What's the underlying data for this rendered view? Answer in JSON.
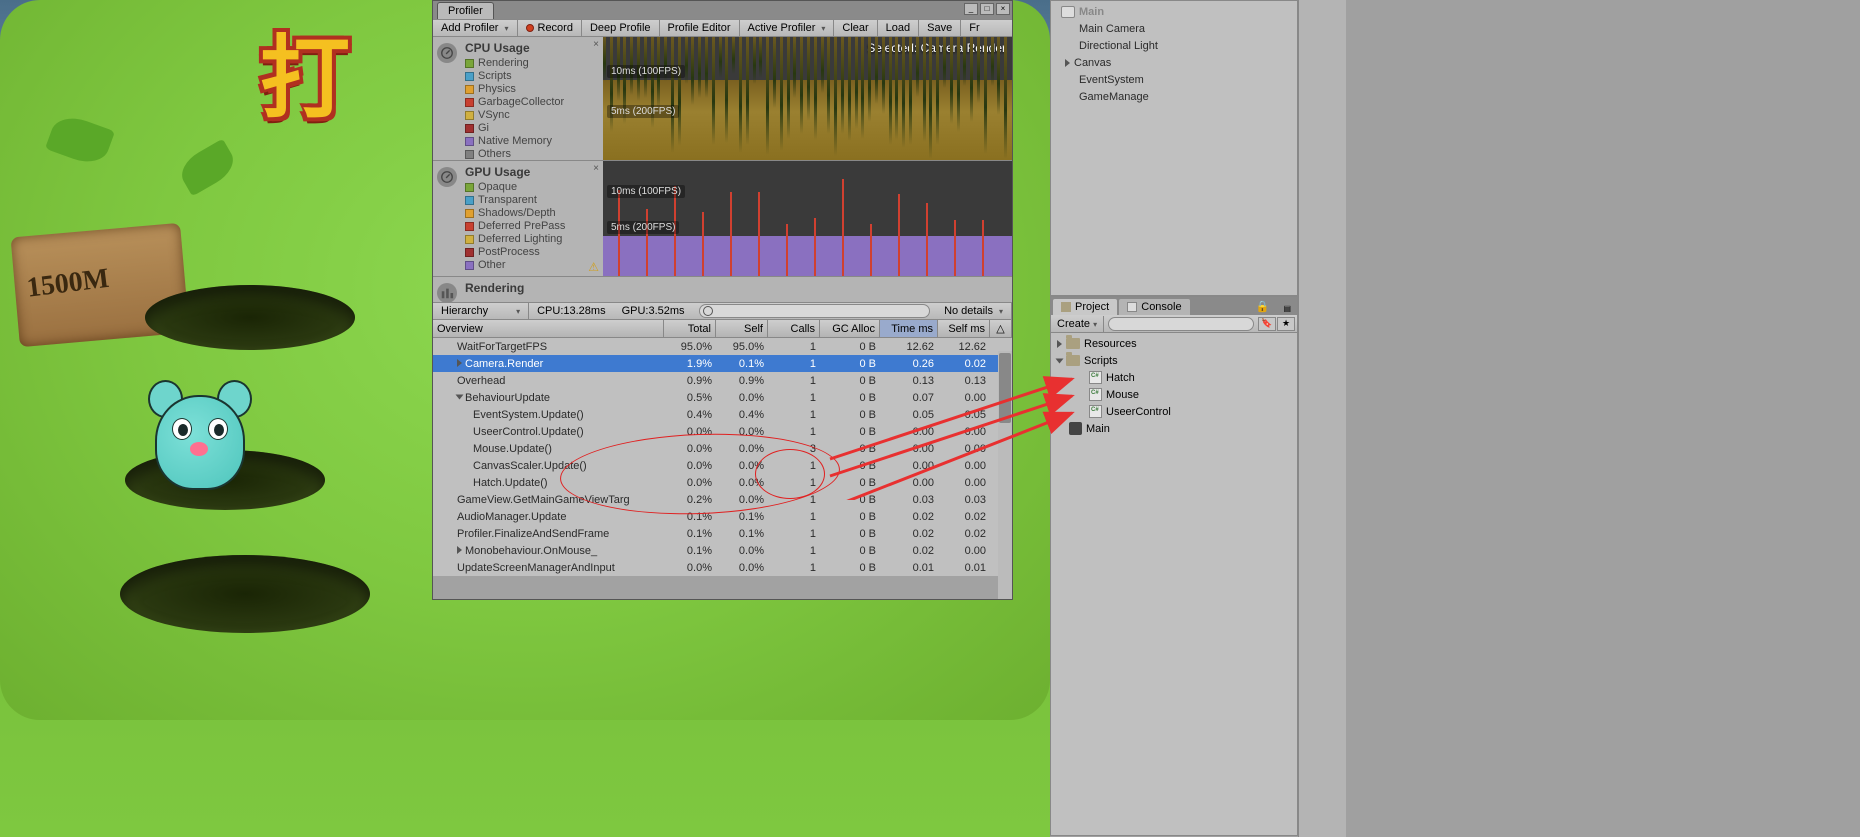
{
  "game": {
    "sign_text": "1500M"
  },
  "profiler": {
    "tab": "Profiler",
    "toolbar": {
      "add": "Add Profiler",
      "record": "Record",
      "deep": "Deep Profile",
      "editor": "Profile Editor",
      "active": "Active Profiler",
      "clear": "Clear",
      "load": "Load",
      "save": "Save",
      "frame": "Fr"
    },
    "cpu": {
      "title": "CPU Usage",
      "selected": "Selected: Camera.Render",
      "labels": {
        "l10": "10ms (100FPS)",
        "l5": "5ms (200FPS)"
      },
      "legend": [
        {
          "name": "Rendering",
          "color": "#7aa63a"
        },
        {
          "name": "Scripts",
          "color": "#4aa0c8"
        },
        {
          "name": "Physics",
          "color": "#e0a030"
        },
        {
          "name": "GarbageCollector",
          "color": "#c84030"
        },
        {
          "name": "VSync",
          "color": "#d0b040"
        },
        {
          "name": "Gi",
          "color": "#a03030"
        },
        {
          "name": "Native Memory",
          "color": "#8a70c0"
        },
        {
          "name": "Others",
          "color": "#808080"
        }
      ]
    },
    "gpu": {
      "title": "GPU Usage",
      "labels": {
        "l10": "10ms (100FPS)",
        "l5": "5ms (200FPS)"
      },
      "legend": [
        {
          "name": "Opaque",
          "color": "#7aa63a"
        },
        {
          "name": "Transparent",
          "color": "#4aa0c8"
        },
        {
          "name": "Shadows/Depth",
          "color": "#e0a030"
        },
        {
          "name": "Deferred PrePass",
          "color": "#c84030"
        },
        {
          "name": "Deferred Lighting",
          "color": "#d0b040"
        },
        {
          "name": "PostProcess",
          "color": "#a03030"
        },
        {
          "name": "Other",
          "color": "#8a70c0"
        }
      ]
    },
    "rendering": {
      "title": "Rendering"
    },
    "details": {
      "mode": "Hierarchy",
      "cpu_stat": "CPU:13.28ms",
      "gpu_stat": "GPU:3.52ms",
      "no_details": "No details"
    },
    "columns": {
      "overview": "Overview",
      "total": "Total",
      "self": "Self",
      "calls": "Calls",
      "gc": "GC Alloc",
      "time": "Time ms",
      "selfms": "Self ms",
      "tri": "△"
    },
    "rows": [
      {
        "name": "WaitForTargetFPS",
        "indent": 1,
        "total": "95.0%",
        "self": "95.0%",
        "calls": "1",
        "gc": "0 B",
        "time": "12.62",
        "selfms": "12.62"
      },
      {
        "name": "Camera.Render",
        "indent": 1,
        "fold": true,
        "total": "1.9%",
        "self": "0.1%",
        "calls": "1",
        "gc": "0 B",
        "time": "0.26",
        "selfms": "0.02",
        "selected": true
      },
      {
        "name": "Overhead",
        "indent": 1,
        "total": "0.9%",
        "self": "0.9%",
        "calls": "1",
        "gc": "0 B",
        "time": "0.13",
        "selfms": "0.13"
      },
      {
        "name": "BehaviourUpdate",
        "indent": 1,
        "fold": true,
        "open": true,
        "total": "0.5%",
        "self": "0.0%",
        "calls": "1",
        "gc": "0 B",
        "time": "0.07",
        "selfms": "0.00"
      },
      {
        "name": "EventSystem.Update()",
        "indent": 2,
        "total": "0.4%",
        "self": "0.4%",
        "calls": "1",
        "gc": "0 B",
        "time": "0.05",
        "selfms": "0.05"
      },
      {
        "name": "UseerControl.Update()",
        "indent": 2,
        "total": "0.0%",
        "self": "0.0%",
        "calls": "1",
        "gc": "0 B",
        "time": "0.00",
        "selfms": "0.00"
      },
      {
        "name": "Mouse.Update()",
        "indent": 2,
        "total": "0.0%",
        "self": "0.0%",
        "calls": "3",
        "gc": "0 B",
        "time": "0.00",
        "selfms": "0.00"
      },
      {
        "name": "CanvasScaler.Update()",
        "indent": 2,
        "total": "0.0%",
        "self": "0.0%",
        "calls": "1",
        "gc": "0 B",
        "time": "0.00",
        "selfms": "0.00"
      },
      {
        "name": "Hatch.Update()",
        "indent": 2,
        "total": "0.0%",
        "self": "0.0%",
        "calls": "1",
        "gc": "0 B",
        "time": "0.00",
        "selfms": "0.00"
      },
      {
        "name": "GameView.GetMainGameViewTarg",
        "indent": 1,
        "total": "0.2%",
        "self": "0.0%",
        "calls": "1",
        "gc": "0 B",
        "time": "0.03",
        "selfms": "0.03"
      },
      {
        "name": "AudioManager.Update",
        "indent": 1,
        "total": "0.1%",
        "self": "0.1%",
        "calls": "1",
        "gc": "0 B",
        "time": "0.02",
        "selfms": "0.02"
      },
      {
        "name": "Profiler.FinalizeAndSendFrame",
        "indent": 1,
        "total": "0.1%",
        "self": "0.1%",
        "calls": "1",
        "gc": "0 B",
        "time": "0.02",
        "selfms": "0.02"
      },
      {
        "name": "Monobehaviour.OnMouse_",
        "indent": 1,
        "fold": true,
        "total": "0.1%",
        "self": "0.0%",
        "calls": "1",
        "gc": "0 B",
        "time": "0.02",
        "selfms": "0.00"
      },
      {
        "name": "UpdateScreenManagerAndInput",
        "indent": 1,
        "total": "0.0%",
        "self": "0.0%",
        "calls": "1",
        "gc": "0 B",
        "time": "0.01",
        "selfms": "0.01"
      }
    ]
  },
  "hierarchy": {
    "top_cut": "Main",
    "items": [
      "Main Camera",
      "Directional Light",
      "Canvas",
      "EventSystem",
      "GameManage"
    ],
    "canvas_fold": true
  },
  "project": {
    "tabs": {
      "project": "Project",
      "console": "Console"
    },
    "create": "Create",
    "tree": {
      "resources": "Resources",
      "scripts": "Scripts",
      "scripts_children": [
        "Hatch",
        "Mouse",
        "UseerControl"
      ],
      "main": "Main"
    }
  }
}
